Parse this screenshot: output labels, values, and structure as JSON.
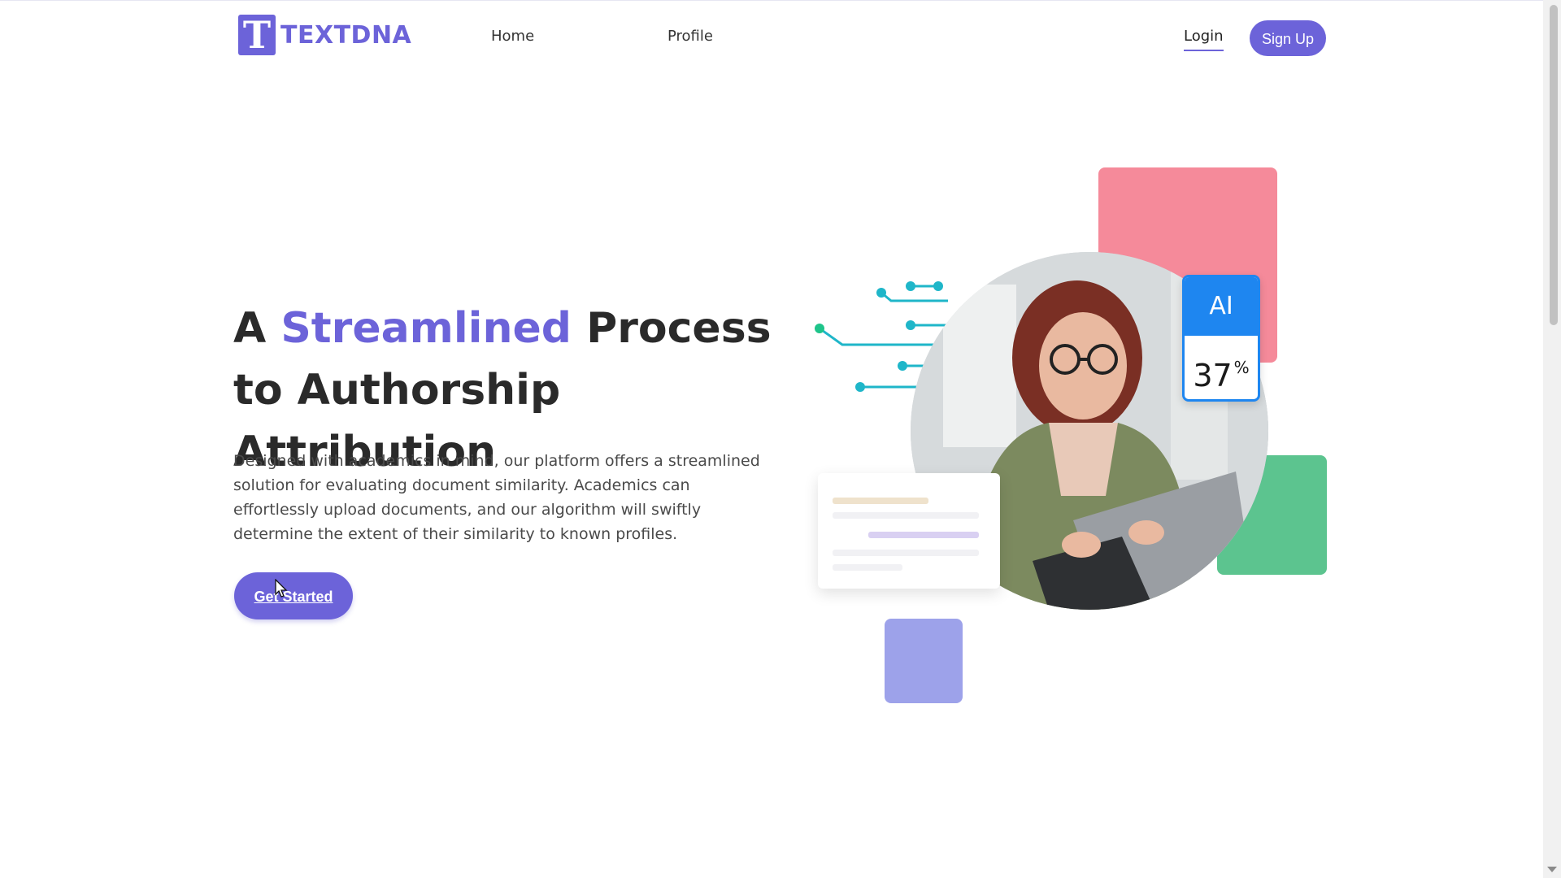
{
  "brand": {
    "name": "TEXTDNA",
    "logo_letter": "T",
    "accent_color": "#6c63d9"
  },
  "nav": {
    "items": [
      {
        "label": "Home"
      },
      {
        "label": "Profile"
      }
    ],
    "login_label": "Login",
    "signup_label": "Sign Up"
  },
  "hero": {
    "title_prefix": "A",
    "title_accent": "Streamlined",
    "title_rest": "Process to Authorship Attribution",
    "description": "Designed with academics in mind, our platform offers a streamlined solution for evaluating document similarity. Academics can effortlessly upload documents, and our algorithm will swiftly determine the extent of their similarity to known profiles.",
    "cta_label": "Get Started"
  },
  "illustration": {
    "ai_label": "AI",
    "ai_value": "37",
    "ai_unit": "%",
    "colors": {
      "pink": "#f58a9a",
      "green": "#5cc48f",
      "purple": "#9da2ea",
      "ai_blue": "#1e86f0",
      "circuit": "#1fb6c9"
    }
  }
}
